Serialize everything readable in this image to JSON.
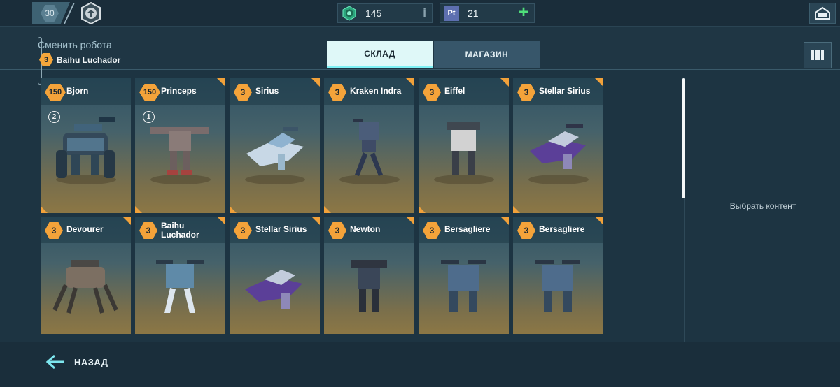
{
  "topbar": {
    "level": "30",
    "currencies": [
      {
        "name": "silver",
        "value": "145",
        "action": "i"
      },
      {
        "name": "platinum",
        "icon_text": "Pt",
        "value": "21",
        "action": "+"
      }
    ]
  },
  "header": {
    "change_robot_title": "Сменить робота",
    "current_robot": {
      "rank": "3",
      "name": "Baihu Luchador"
    },
    "tabs": [
      {
        "label": "СКЛАД",
        "active": true
      },
      {
        "label": "МАГАЗИН",
        "active": false
      }
    ]
  },
  "cards": [
    {
      "rank": "150",
      "name": "Bjorn",
      "copies": "2"
    },
    {
      "rank": "150",
      "name": "Princeps",
      "copies": "1"
    },
    {
      "rank": "3",
      "name": "Sirius"
    },
    {
      "rank": "3",
      "name": "Kraken Indra"
    },
    {
      "rank": "3",
      "name": "Eiffel"
    },
    {
      "rank": "3",
      "name": "Stellar Sirius"
    },
    {
      "rank": "3",
      "name": "Devourer"
    },
    {
      "rank": "3",
      "name": "Baihu Luchador"
    },
    {
      "rank": "3",
      "name": "Stellar Sirius"
    },
    {
      "rank": "3",
      "name": "Newton"
    },
    {
      "rank": "3",
      "name": "Bersagliere"
    },
    {
      "rank": "3",
      "name": "Bersagliere"
    }
  ],
  "side_panel": {
    "text": "Выбрать контент"
  },
  "footer": {
    "back_label": "НАЗАД"
  },
  "colors": {
    "accent_orange": "#f4a33a",
    "active_tab": "#dff8f8",
    "plus_green": "#4fe07a"
  }
}
